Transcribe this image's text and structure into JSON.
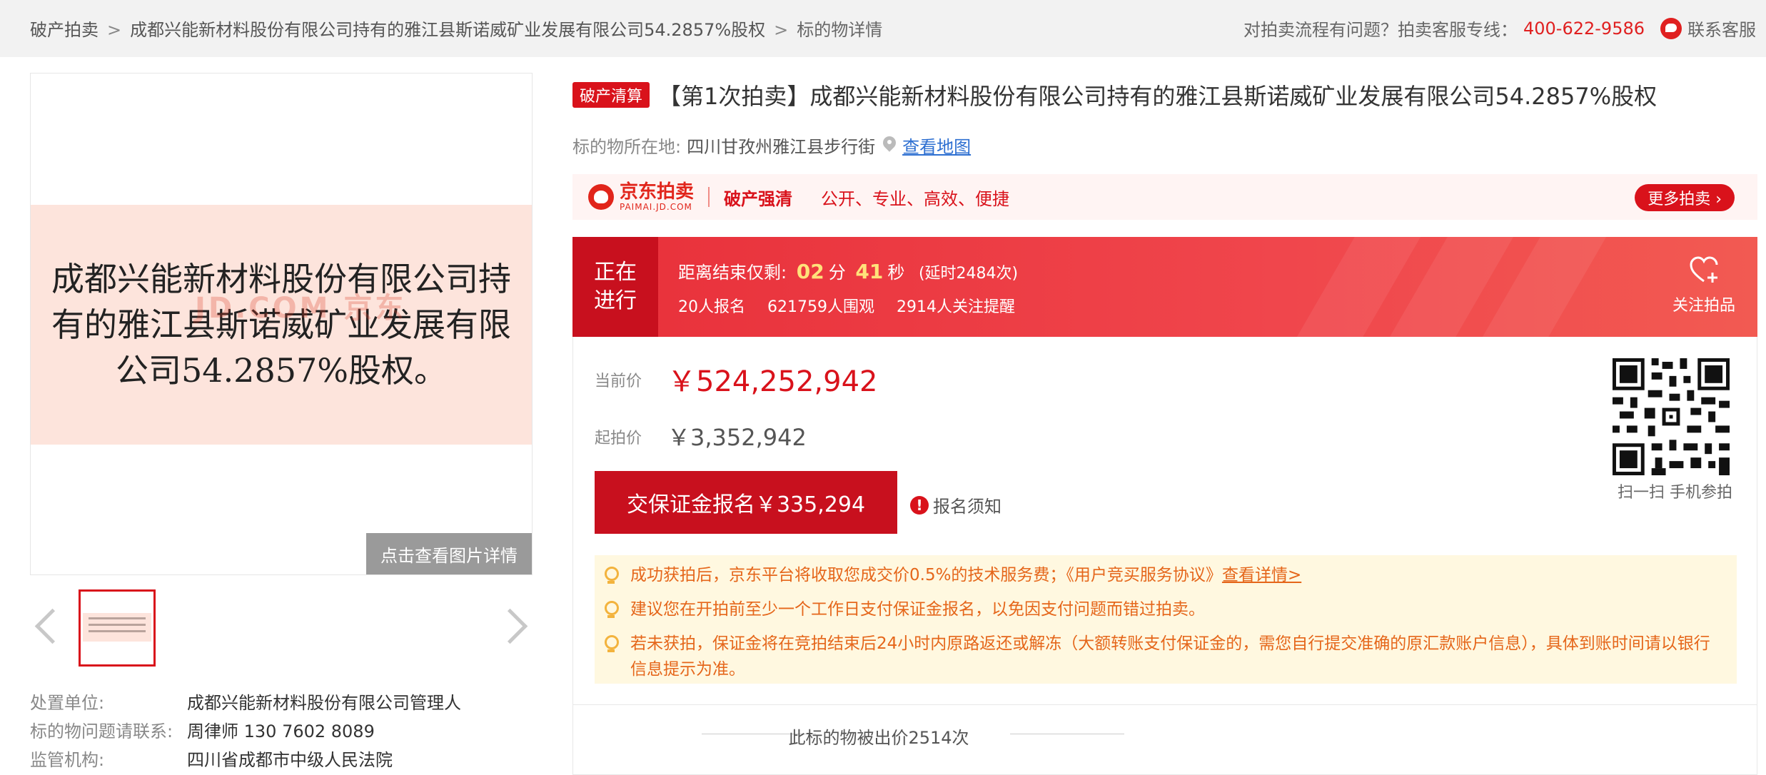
{
  "breadcrumb": {
    "items": [
      "破产拍卖",
      "成都兴能新材料股份有限公司持有的雅江县斯诺威矿业发展有限公司54.2857%股权",
      "标的物详情"
    ],
    "separator": ">"
  },
  "topbar": {
    "help_text": "对拍卖流程有问题？拍卖客服专线：",
    "phone": "400-622-9586",
    "contact_label": "联系客服"
  },
  "gallery": {
    "doc_text": "成都兴能新材料股份有限公司持有的雅江县斯诺威矿业发展有限公司54.2857%股权。",
    "view_detail_label": "点击查看图片详情"
  },
  "info": {
    "rows": [
      {
        "key": "处置单位:",
        "value": "成都兴能新材料股份有限公司管理人"
      },
      {
        "key": "标的物问题请联系:",
        "value": "周律师 130 7602 8089"
      },
      {
        "key": "监管机构:",
        "value": "四川省成都市中级人民法院"
      }
    ]
  },
  "item": {
    "tag": "破产清算",
    "title": "【第1次拍卖】成都兴能新材料股份有限公司持有的雅江县斯诺威矿业发展有限公司54.2857%股权",
    "location_label": "标的物所在地:",
    "location": "四川甘孜州雅江县步行街",
    "map_link": "查看地图"
  },
  "banner": {
    "logo_big": "京东拍卖",
    "logo_small": "PAIMAI.JD.COM",
    "slogan1": "破产强清",
    "slogan2": "公开、专业、高效、便捷",
    "more_label": "更多拍卖 ›"
  },
  "status": {
    "state_line1": "正在",
    "state_line2": "进行",
    "countdown_label": "距离结束仅剩:",
    "minutes": "02",
    "minutes_unit": "分",
    "seconds": "41",
    "seconds_unit": "秒",
    "extension": "(延时2484次)",
    "signups": "20人报名",
    "viewers": "621759人围观",
    "watchers": "2914人关注提醒",
    "follow_label": "关注拍品"
  },
  "price": {
    "current_label": "当前价",
    "current_value": "￥524,252,942",
    "start_label": "起拍价",
    "start_value": "￥3,352,942",
    "bid_button": "交保证金报名￥335,294",
    "notice_label": "报名须知",
    "qr_label": "扫一扫 手机参拍"
  },
  "tips": [
    {
      "text": "成功获拍后，京东平台将收取您成交价0.5%的技术服务费；《用户竞买服务协议》",
      "link": "查看详情>"
    },
    {
      "text": "建议您在开拍前至少一个工作日支付保证金报名，以免因支付问题而错过拍卖。",
      "link": ""
    },
    {
      "text": "若未获拍，保证金将在竞拍结束后24小时内原路返还或解冻（大额转账支付保证金的，需您自行提交准确的原汇款账户信息），具体到账时间请以银行信息提示为准。",
      "link": ""
    }
  ],
  "bids": {
    "count_label": "此标的物被出价2514次"
  },
  "colors": {
    "accent": "#d9121b",
    "status_bg": "#e8303a",
    "tip_text": "#e5661a",
    "tip_bg": "#fff8e0",
    "link": "#2d6fd1"
  }
}
